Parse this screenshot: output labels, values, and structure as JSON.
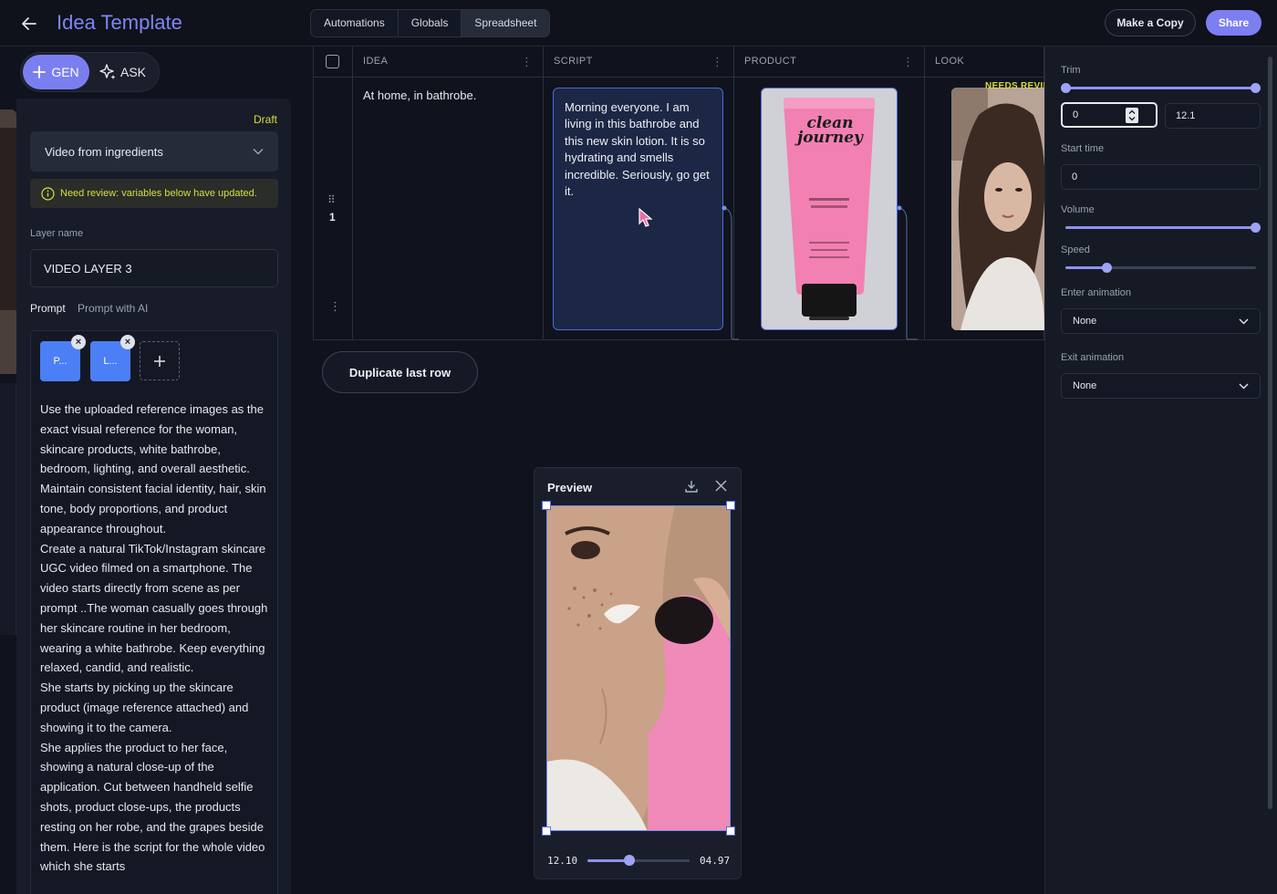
{
  "header": {
    "title": "Idea Template",
    "tabs": [
      "Automations",
      "Globals",
      "Spreadsheet"
    ],
    "active_tab": "Spreadsheet",
    "make_copy_label": "Make a Copy",
    "share_label": "Share"
  },
  "mode": {
    "gen_label": "GEN",
    "ask_label": "ASK"
  },
  "left_panel": {
    "status": "Draft",
    "workflow_select": "Video from ingredients",
    "warning": "Need review: variables below have updated.",
    "layer_name_label": "Layer name",
    "layer_name_value": "VIDEO LAYER 3",
    "prompt_tab": "Prompt",
    "prompt_ai_tab": "Prompt with AI",
    "chips": [
      "P...",
      "L..."
    ],
    "prompt_text": "Use the uploaded reference images as the exact visual reference for the woman, skincare products, white bathrobe, bedroom, lighting, and overall aesthetic. Maintain consistent facial identity, hair, skin tone, body proportions, and product appearance throughout.\nCreate a natural TikTok/Instagram skincare UGC video filmed on a smartphone. The video starts directly from scene as per prompt  ..The woman casually goes through her skincare routine in her bedroom, wearing a white bathrobe. Keep everything relaxed, candid, and realistic.\nShe starts by picking up the skincare product (image reference attached) and showing it to the camera.\nShe applies the product to her face, showing a natural close-up of the application. Cut between handheld selfie shots, product close-ups, the products resting on her robe, and the grapes beside them. Here is the script for the whole video which she starts"
  },
  "sheet": {
    "columns": [
      "IDEA",
      "SCRIPT",
      "PRODUCT",
      "LOOK"
    ],
    "rows": [
      {
        "num": "1",
        "idea": "At home, in bathrobe.",
        "script": "Morning everyone. I am living in this bathrobe and this new skin lotion. It is so hydrating and smells incredible. Seriously, go get it.",
        "product_brand": "clean journey",
        "look_status": "NEEDS REVIE"
      }
    ],
    "duplicate_label": "Duplicate last row"
  },
  "preview": {
    "title": "Preview",
    "time_left": "12.10",
    "time_right": "04.97",
    "progress": 0.41
  },
  "properties": {
    "trim_label": "Trim",
    "trim_start": "0",
    "trim_end": "12.1",
    "start_time_label": "Start time",
    "start_time": "0",
    "volume_label": "Volume",
    "volume": 1.0,
    "speed_label": "Speed",
    "speed": 0.22,
    "enter_anim_label": "Enter animation",
    "enter_anim": "None",
    "exit_anim_label": "Exit animation",
    "exit_anim": "None"
  },
  "colors": {
    "accent": "#7b7ff0",
    "warning": "#d7dc3a",
    "selection": "#4c6ad8"
  }
}
